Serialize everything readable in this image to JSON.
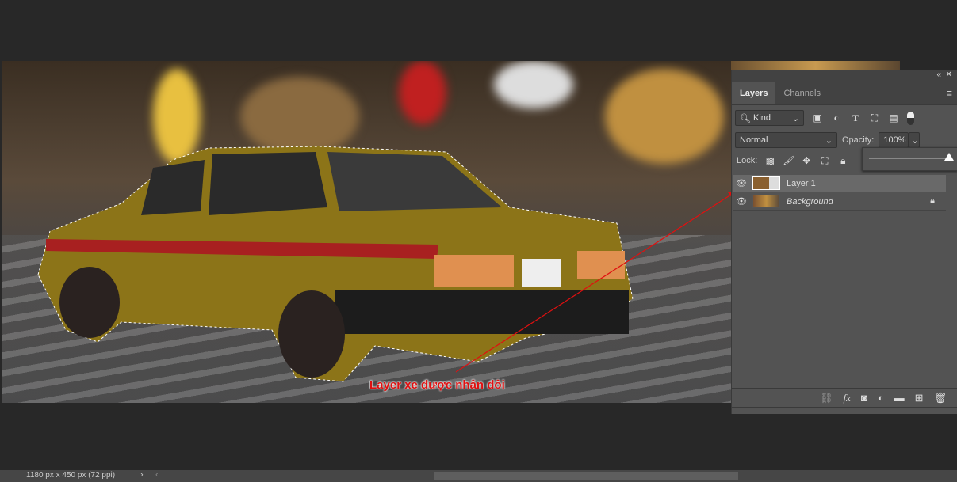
{
  "panel": {
    "tabs": [
      {
        "label": "Layers"
      },
      {
        "label": "Channels"
      }
    ],
    "filter": "Kind",
    "blend_mode": "Normal",
    "opacity_label": "Opacity:",
    "opacity_value": "100%",
    "opacity_slider_percent": 100,
    "lock_label": "Lock:",
    "layers": [
      {
        "name": "Layer 1",
        "visible": true,
        "selected": true
      },
      {
        "name": "Background",
        "visible": true,
        "locked": true
      }
    ]
  },
  "annotation": {
    "text": "Layer xe được nhân đôi",
    "color": "#e01010"
  },
  "status": {
    "doc_info": "1180 px x 450 px (72 ppi)"
  }
}
